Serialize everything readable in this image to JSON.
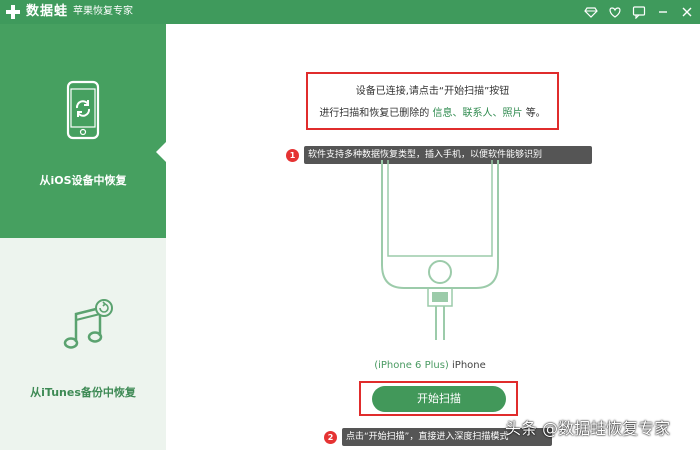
{
  "titlebar": {
    "brand": "数据蛙",
    "product": "苹果恢复专家",
    "icons": [
      "diamond-icon",
      "heart-icon",
      "chat-icon",
      "minimize-icon",
      "close-icon"
    ]
  },
  "sidebar": {
    "items": [
      {
        "label": "从iOS设备中恢复",
        "icon": "phone-refresh-icon",
        "active": true
      },
      {
        "label": "从iTunes备份中恢复",
        "icon": "music-refresh-icon",
        "active": false
      }
    ]
  },
  "main": {
    "instruction_line1": "设备已连接,请点击“开始扫描”按钮",
    "instruction_line2_prefix": "进行扫描和恢复已删除的",
    "instruction_line2_items": "信息、联系人、照片",
    "instruction_line2_suffix": "等。",
    "tip1_number": "1",
    "tip1_text": "软件支持多种数据恢复类型，插入手机，以便软件能够识别",
    "device_model_paren": "(iPhone 6 Plus)",
    "device_name": "iPhone",
    "scan_button": "开始扫描",
    "tip2_number": "2",
    "tip2_text": "点击“开始扫描”，直接进入深度扫描模式"
  },
  "watermark": "头条 @数据蛙恢复专家",
  "colors": {
    "brand_green": "#3f9a5c",
    "sidebar_active": "#46a060",
    "highlight_red": "#e02c2c"
  }
}
